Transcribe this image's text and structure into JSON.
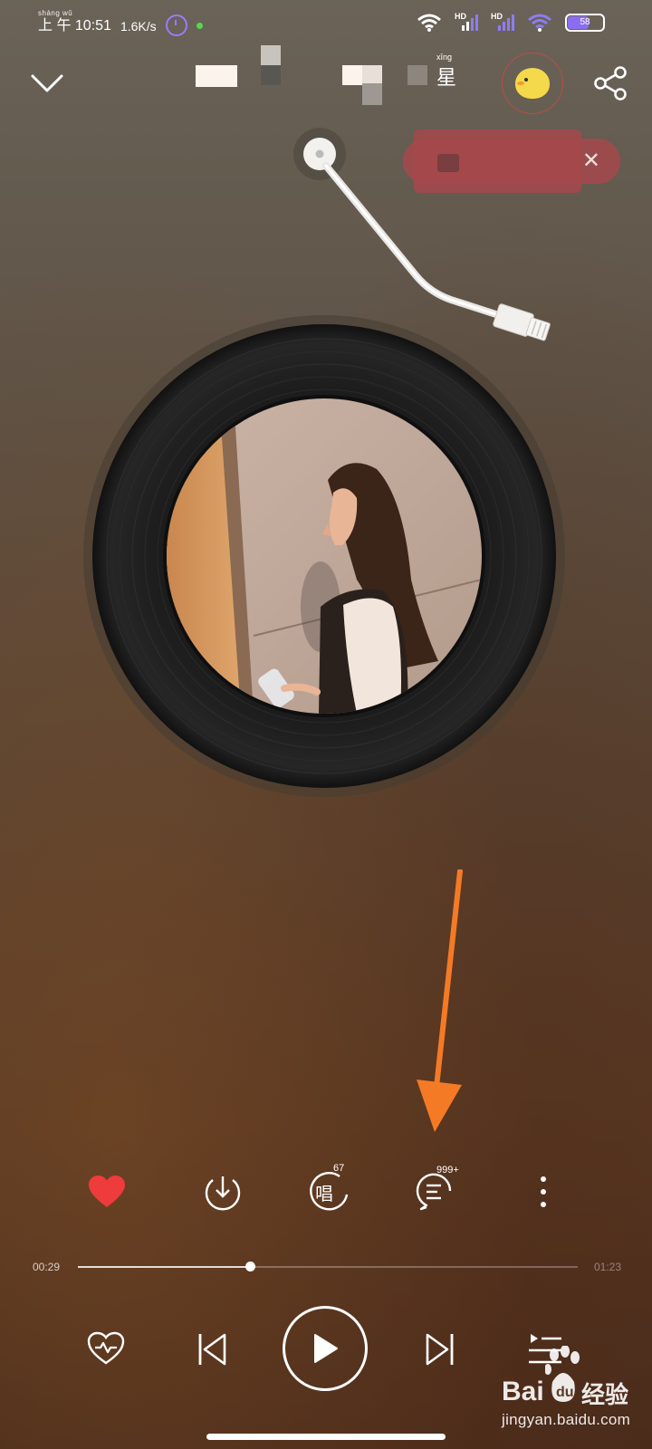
{
  "status_bar": {
    "pinyin": "shàng wǔ",
    "time": "上 午 10:51",
    "net_speed": "1.6K/s",
    "hd_1": "HD",
    "hd_2": "HD",
    "battery_level": "58"
  },
  "header": {
    "title_glyph": "星",
    "title_superscript": "xīng",
    "collapse_icon": "chevron-down-icon",
    "share_icon": "share-icon"
  },
  "banner": {
    "close_label": "✕"
  },
  "actions": {
    "sing_glyph": "唱",
    "sing_count": "67",
    "comment_count": "999+",
    "icons": [
      "heart-filled-icon",
      "download-icon",
      "sing-icon",
      "comment-icon",
      "more-icon"
    ],
    "heart_color": "#ee3b3b"
  },
  "progress": {
    "current_time": "00:29",
    "total_time": "01:23",
    "fraction": 0.345
  },
  "controls": {
    "icons": [
      "heart-wave-icon",
      "previous-icon",
      "play-icon",
      "next-icon",
      "playlist-icon"
    ]
  },
  "watermark": {
    "brand": "Bai",
    "brand_suffix": "经验",
    "url": "jingyan.baidu.com"
  },
  "annotation": {
    "arrow_color": "#f47a26"
  }
}
